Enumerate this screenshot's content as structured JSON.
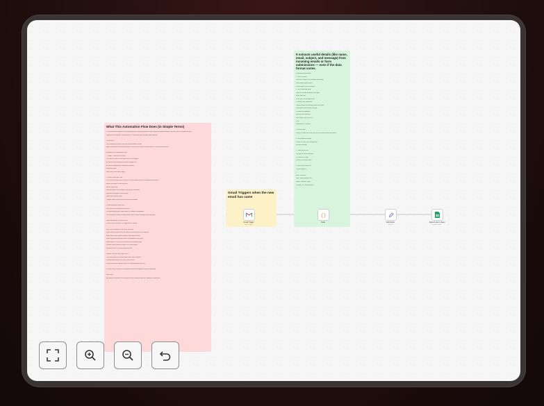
{
  "notes": {
    "overview": {
      "title": "What This Automation Flow Does (in Simple Terms)",
      "lines": [
        "This automation is designed to automatically process incoming customer emails, extract the important details, and save them to a database or your",
        "system (such as Airtable, a spreadsheet, or CRM) without you needing to type anything.",
        "",
        "In Short form:",
        "Use a templated platform where the whole workflow is made.",
        "Allows, hands-free automated reporting to save all the necessary customer data in a structured data format.",
        "",
        "Breakdown of the Automation Flow",
        "1. Trigger – New Email Received",
        "The flow starts when a new email arrives. For example:",
        "A customer form submission from your Shopify store",
        "A customer sending you a question or feedback",
        "A support request",
        "Node used: Gmail Email Trigger",
        "",
        "2. Extract Details with Code",
        "This is the core logic where we parse the email content and pick out important data fields.",
        "Extract the sender's name and email",
        "Get the subject line",
        "Read the body of the message to find specific information",
        "Structure everything in a clean format",
        "Node used: Function Node",
        "Purpose: Makes the raw data structured and readable",
        "",
        "3. Save to Airtable or any CRM",
        "Once the data is extracted and cleaned:",
        "It is sent directly to your chosen base, for example RecordsInbox",
        "The record gets created, including Name, Email, Subject, Message, and Timestamp",
        "",
        "Node used: Airtable / Create Record",
        "You can also send them to a Google Sheet or similar",
        "",
        "Why This is Valuable for You or Your Business:",
        "Saves hours of manual work: No need to read every email and copy data",
        "Never miss a lead: Every message is captured and stored",
        "Better organization: All your contacts and requests in one place",
        "Easy analysis: Use the data to see trends and respond faster",
        "Scalable: Works whether you get 10 or 10,000 emails",
        "Automation runs 24/7 without any extra staff",
        "",
        "Optional: Take the Code Logic Further",
        "The JavaScript in the function node is like a smart assistant",
        "It understands emails in the way a human would",
        "It extracts questions, product details, or anything specific you need",
        "",
        "In future: You can feed it to a dashboard or add AI to respond to emails automatically",
        "",
        "Final Result",
        "All emails are converted into structured records, ready for follow-up, reporting, or automation."
      ]
    },
    "extract": {
      "title": "It extracts useful details (like name, email, subject, and message) from incoming emails or form submissions — even if the data format varies.",
      "lines": [
        "Step-by-Step Explanation",
        "1. Get the Content",
        "Looks for a subject line or text/plain email body",
        "Email Subject: $json.subject",
        "If none found, it sets: No Subject",
        "2. Get the Message Body",
        "Looks for the main message in text/plain",
        "Body: $json.text",
        "If not found: No message found",
        "3. Identify Form Submission",
        "Checks whether the message came from a form",
        "Form Fields: Name, Email, Message",
        "4. Extract Email Address",
        "Finds email in From field",
        "Uses Regex: /[\\w.-]+@[\\w.-]+/",
        "If not:",
        "senderEmail = 'Unknown'",
        "",
        "5. Extract Name",
        "If name is found in the From field use it, otherwise extract from email",
        "",
        "6. Get the Actual Message",
        "If there is a form, take message field",
        "Else take full body",
        "",
        "7. Clean Up the Data",
        "Trim spaces, clean characters",
        "8. Format the Output",
        "Returns a structured object",
        "",
        "9. Return Structured Data",
        "The final output is:",
        "{",
        "name: 'John Doe',",
        "email: 'john@example.com',",
        "subject: 'Website Inquiry',",
        "message: 'Hi, I am interested...',",
        "}"
      ]
    },
    "trigger": {
      "title": "Gmail Triggers when the new email has came"
    }
  },
  "nodes": [
    {
      "label": "Gmail Trigger",
      "sub": "Email Trigger",
      "icon": "gmail-icon"
    },
    {
      "label": "Code",
      "sub": "",
      "icon": "code-icon"
    },
    {
      "label": "Edit Fields",
      "sub": "manual",
      "icon": "pencil-icon"
    },
    {
      "label": "Append row in sheet",
      "sub": "append: sheet",
      "icon": "google-sheets-icon"
    }
  ],
  "toolbar": {
    "fit_view": "fit-view-icon",
    "zoom_in": "zoom-in-icon",
    "zoom_out": "zoom-out-icon",
    "undo": "undo-icon"
  }
}
